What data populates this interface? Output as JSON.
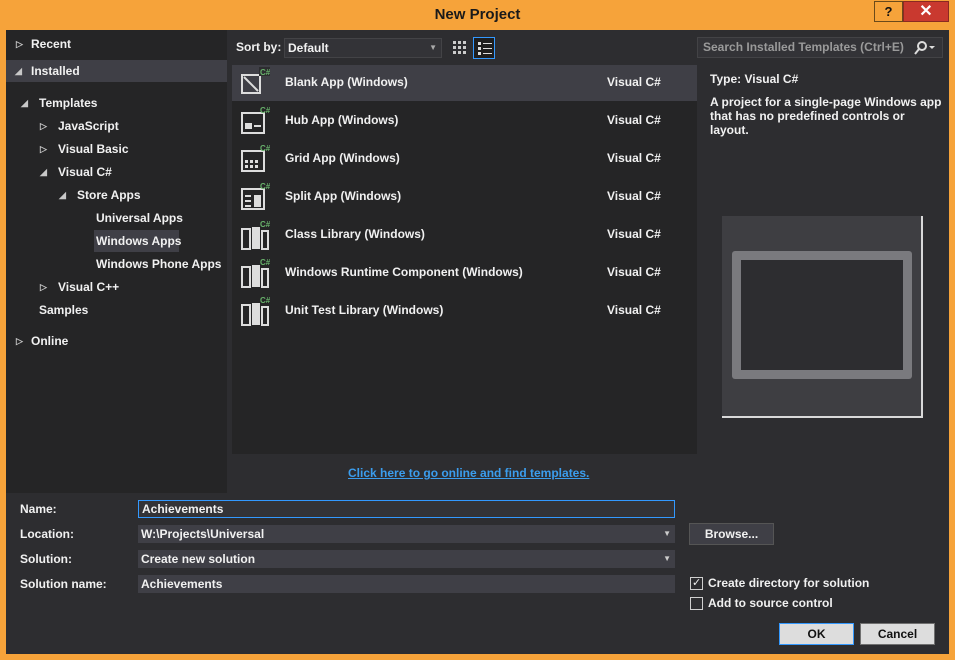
{
  "window": {
    "title": "New Project",
    "help_label": "?",
    "close_label": "✕"
  },
  "tree": {
    "recent": "Recent",
    "installed": "Installed",
    "templates": "Templates",
    "javascript": "JavaScript",
    "visual_basic": "Visual Basic",
    "visual_csharp": "Visual C#",
    "store_apps": "Store Apps",
    "universal_apps": "Universal Apps",
    "windows_apps": "Windows Apps",
    "windows_phone_apps": "Windows Phone Apps",
    "visual_cpp": "Visual C++",
    "samples": "Samples",
    "online": "Online"
  },
  "sort": {
    "label": "Sort by:",
    "value": "Default"
  },
  "search": {
    "placeholder": "Search Installed Templates (Ctrl+E)"
  },
  "templates": [
    {
      "name": "Blank App (Windows)",
      "language": "Visual C#",
      "icon": "blank-app-icon"
    },
    {
      "name": "Hub App (Windows)",
      "language": "Visual C#",
      "icon": "hub-app-icon"
    },
    {
      "name": "Grid App (Windows)",
      "language": "Visual C#",
      "icon": "grid-app-icon"
    },
    {
      "name": "Split App (Windows)",
      "language": "Visual C#",
      "icon": "split-app-icon"
    },
    {
      "name": "Class Library (Windows)",
      "language": "Visual C#",
      "icon": "class-library-icon"
    },
    {
      "name": "Windows Runtime Component (Windows)",
      "language": "Visual C#",
      "icon": "runtime-component-icon"
    },
    {
      "name": "Unit Test Library (Windows)",
      "language": "Visual C#",
      "icon": "unit-test-icon"
    }
  ],
  "description": {
    "type_label": "Type:  Visual C#",
    "text": "A project for a single-page Windows app that has no predefined controls or layout."
  },
  "online_link": "Click here to go online and find templates.",
  "form": {
    "name_label": "Name:",
    "name_value": "Achievements",
    "location_label": "Location:",
    "location_value": "W:\\Projects\\Universal",
    "solution_label": "Solution:",
    "solution_value": "Create new solution",
    "solution_name_label": "Solution name:",
    "solution_name_value": "Achievements",
    "browse_label": "Browse...",
    "create_dir_label": "Create directory for solution",
    "create_dir_checked": true,
    "source_control_label": "Add to source control",
    "source_control_checked": false,
    "ok_label": "OK",
    "cancel_label": "Cancel"
  },
  "colors": {
    "accent": "#f6a33a",
    "link": "#3b9ded",
    "focus": "#3399ff",
    "csharp_badge": "#68b26b"
  }
}
